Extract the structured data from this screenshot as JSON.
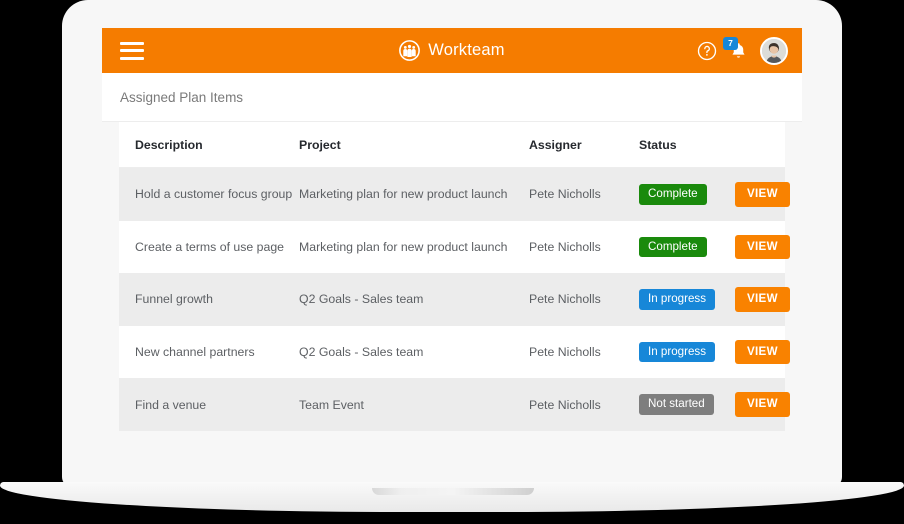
{
  "header": {
    "menu_icon": "hamburger-menu-icon",
    "brand_name": "Workteam",
    "brand_icon": "workteam-logo-icon",
    "help_icon": "question-mark-circle-icon",
    "bell_icon": "notification-bell-icon",
    "notification_count": "7",
    "avatar_icon": "user-avatar",
    "background_color": "#f57c00"
  },
  "page": {
    "title": "Assigned Plan Items"
  },
  "table": {
    "columns": [
      "Description",
      "Project",
      "Assigner",
      "Status",
      ""
    ],
    "rows": [
      {
        "description": "Hold a customer focus group",
        "project": "Marketing plan for new product launch",
        "assigner": "Pete Nicholls",
        "status": "Complete",
        "status_color": "#1a8a0c",
        "action": "VIEW"
      },
      {
        "description": "Create a terms of use page",
        "project": "Marketing plan for new product launch",
        "assigner": "Pete Nicholls",
        "status": "Complete",
        "status_color": "#1a8a0c",
        "action": "VIEW"
      },
      {
        "description": "Funnel growth",
        "project": "Q2 Goals - Sales team",
        "assigner": "Pete Nicholls",
        "status": "In progress",
        "status_color": "#1787d8",
        "action": "VIEW"
      },
      {
        "description": "New channel partners",
        "project": "Q2 Goals - Sales team",
        "assigner": "Pete Nicholls",
        "status": "In progress",
        "status_color": "#1787d8",
        "action": "VIEW"
      },
      {
        "description": "Find a venue",
        "project": "Team Event",
        "assigner": "Pete Nicholls",
        "status": "Not started",
        "status_color": "#7e7e7e",
        "action": "VIEW"
      }
    ]
  },
  "colors": {
    "accent_orange": "#f57c00",
    "button_orange": "#f98200",
    "status_green": "#1a8a0c",
    "status_blue": "#1787d8",
    "status_gray": "#7e7e7e"
  }
}
